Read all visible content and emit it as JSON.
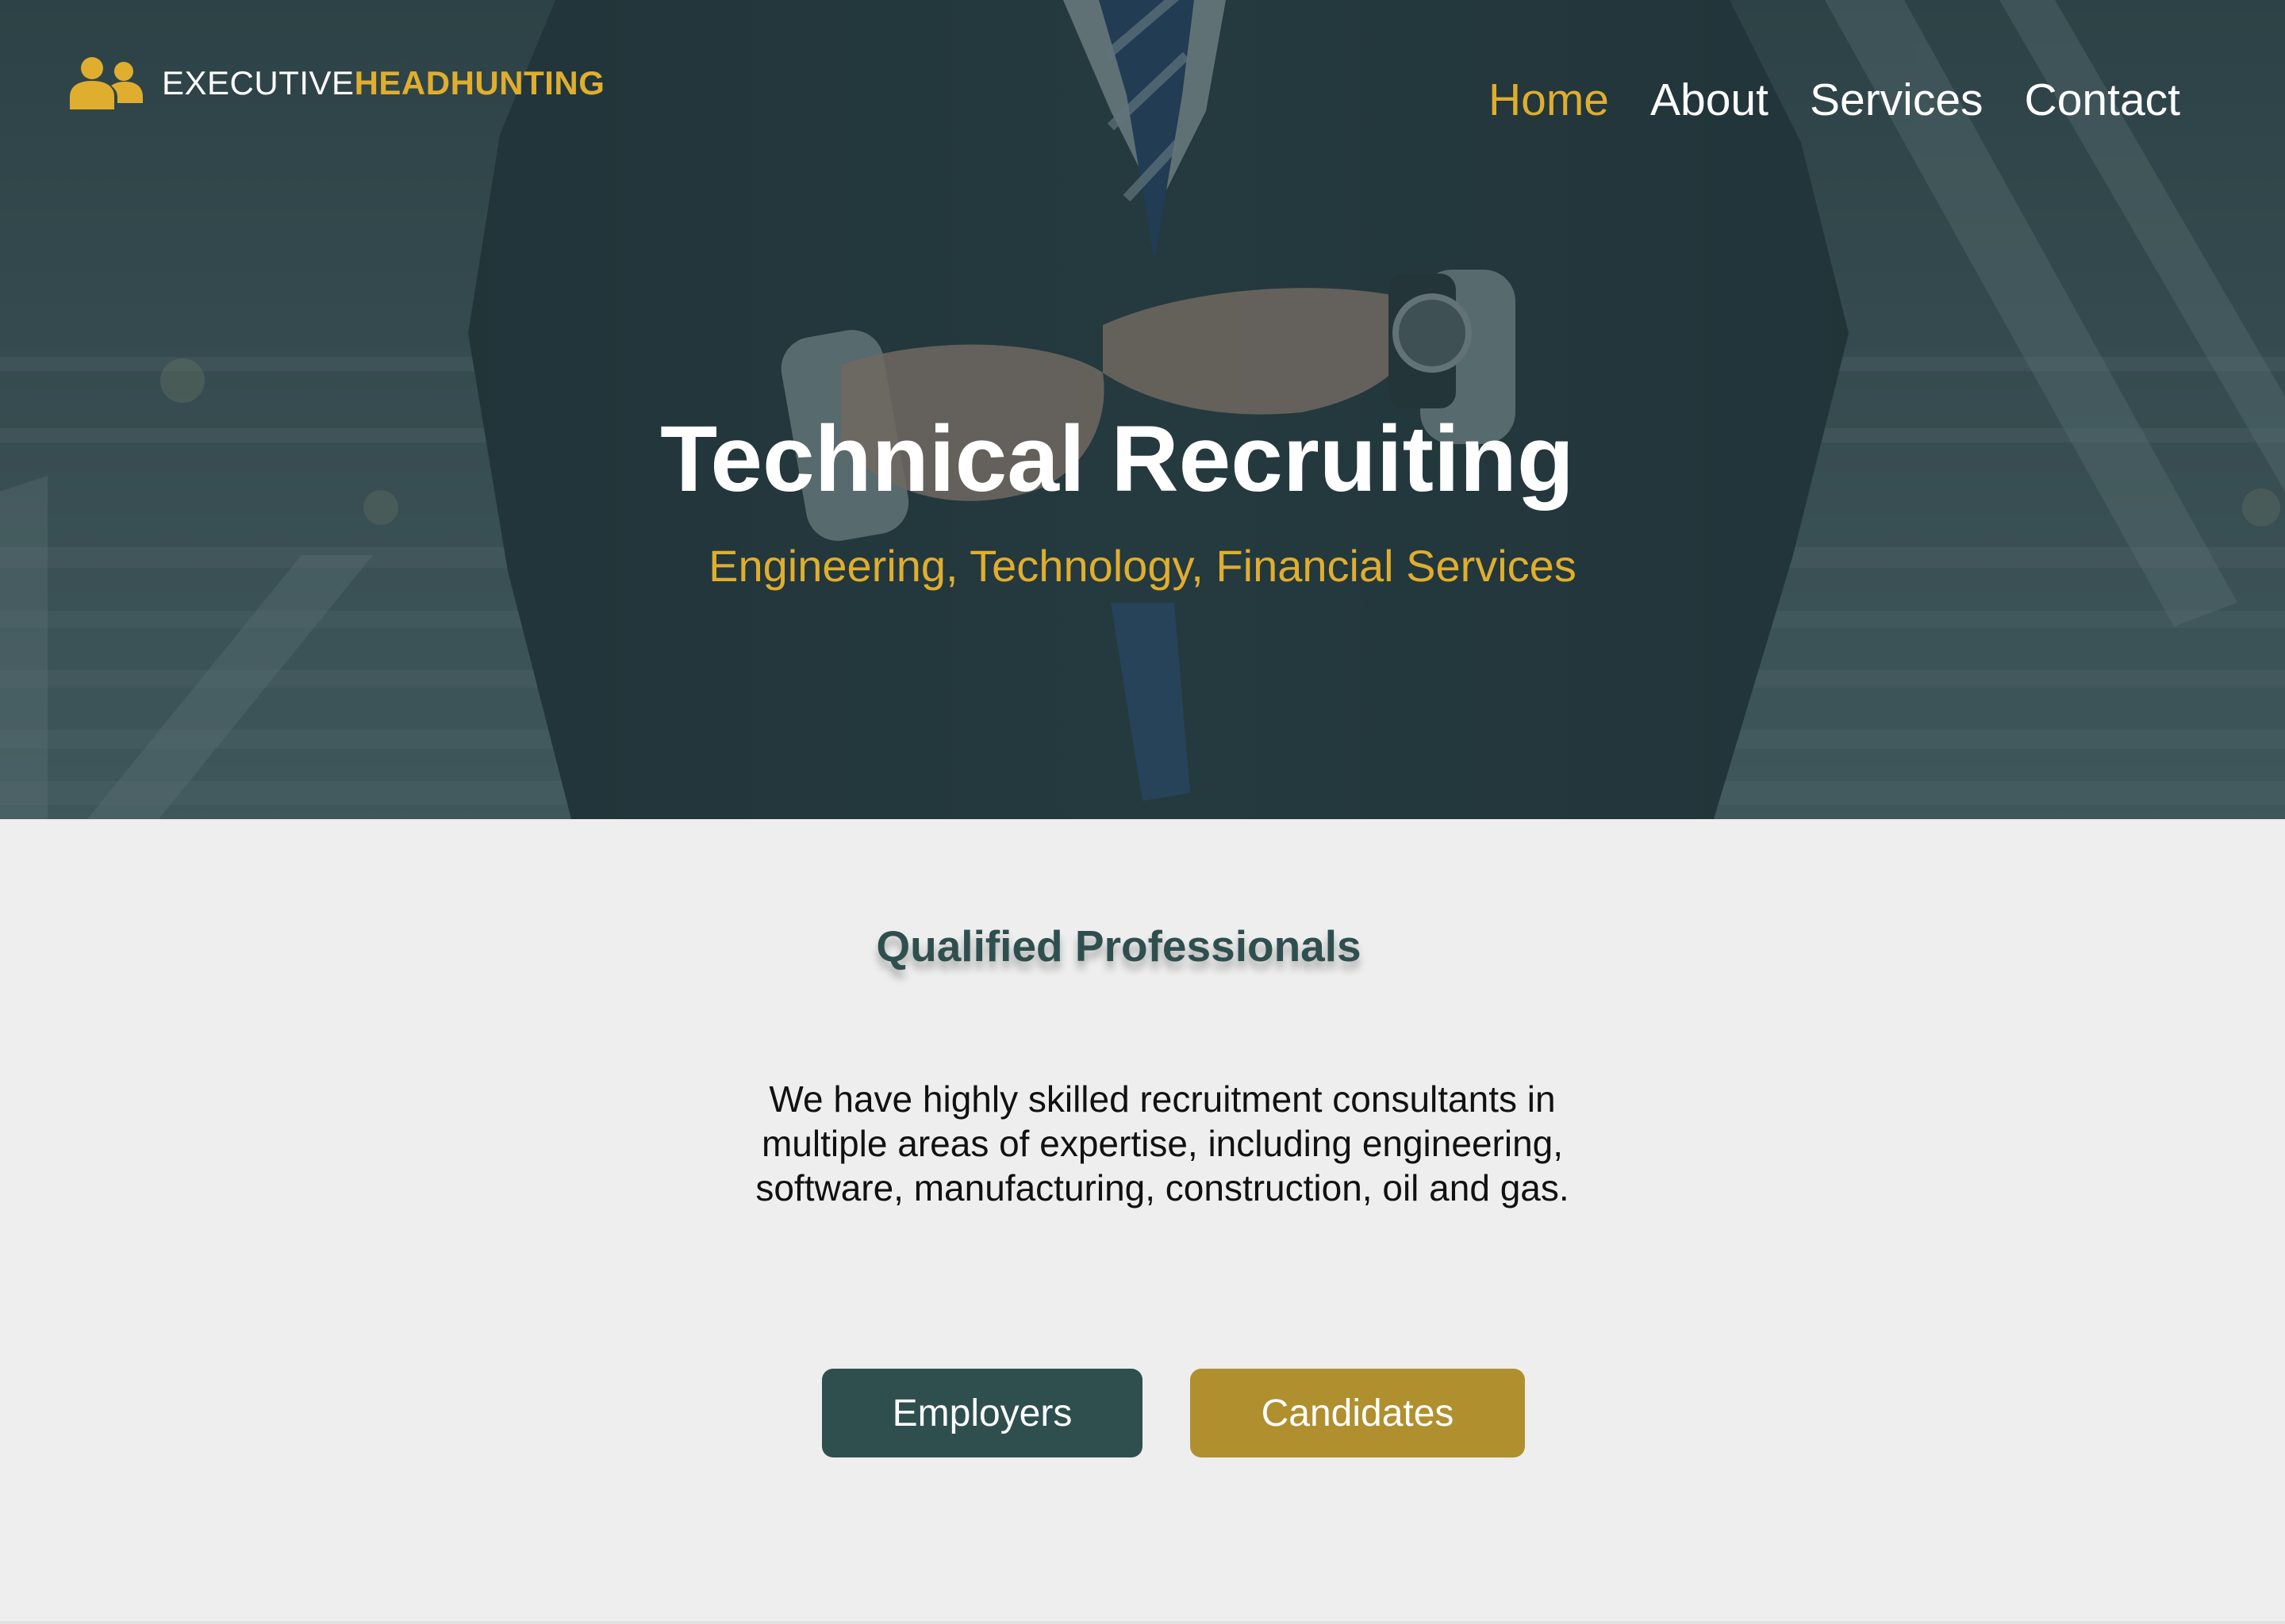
{
  "brand": {
    "part1": "EXECUTIVE",
    "part2": "HEADHUNTING",
    "icon": "users-icon",
    "accent_color": "#e0ae2e"
  },
  "nav": {
    "items": [
      {
        "label": "Home",
        "active": true
      },
      {
        "label": "About",
        "active": false
      },
      {
        "label": "Services",
        "active": false
      },
      {
        "label": "Contact",
        "active": false
      }
    ]
  },
  "hero": {
    "title": "Technical Recruiting",
    "subtitle": "Engineering, Technology, Financial Services",
    "background": "businessman-in-suit-buttoning-jacket-photo"
  },
  "section": {
    "title": "Qualified Professionals",
    "text": "We have highly skilled recruitment consultants in multiple areas of expertise, including engineering, software, manufacturing, construction, oil and gas."
  },
  "buttons": {
    "employers": {
      "label": "Employers",
      "color": "#2f4f4f"
    },
    "candidates": {
      "label": "Candidates",
      "color": "#b08f2f"
    }
  }
}
